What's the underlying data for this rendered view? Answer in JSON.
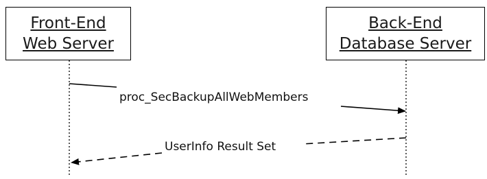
{
  "participants": [
    {
      "id": "front",
      "lines": [
        "Front-End",
        "Web Server"
      ]
    },
    {
      "id": "back",
      "lines": [
        "Back-End",
        "Database Server"
      ]
    }
  ],
  "messages": [
    {
      "label": "proc_SecBackupAllWebMembers",
      "from": "Front-End Web Server",
      "to": "Back-End Database Server",
      "style": "solid"
    },
    {
      "label": "UserInfo Result Set",
      "from": "Back-End Database Server",
      "to": "Front-End Web Server",
      "style": "dashed"
    }
  ]
}
